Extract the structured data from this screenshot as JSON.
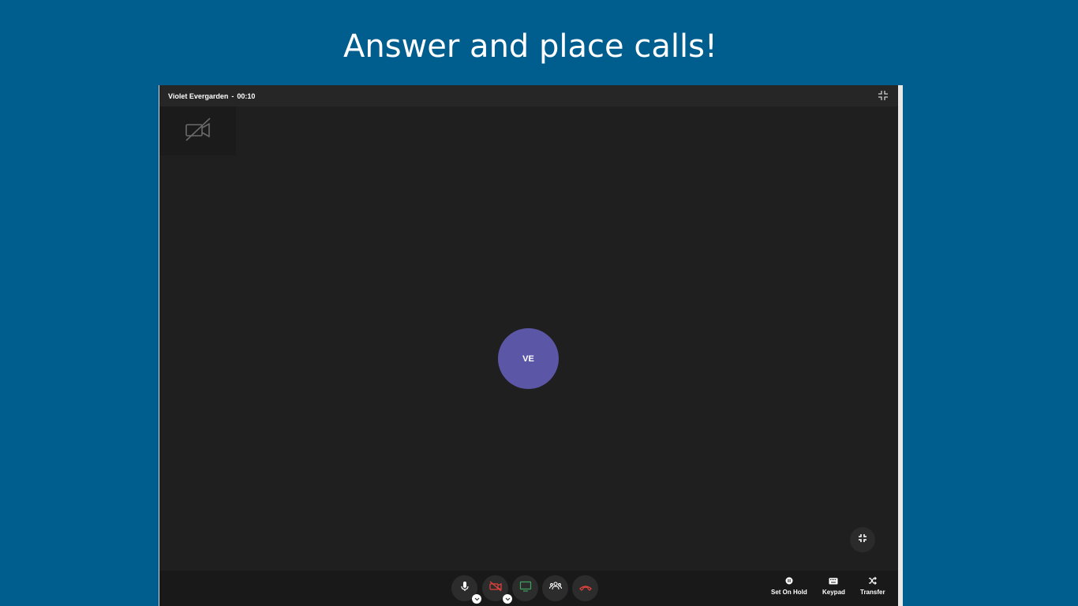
{
  "headline": "Answer and place calls!",
  "call": {
    "contact_name": "Violet Evergarden",
    "separator": "-",
    "duration": "00:10",
    "avatar_initials": "VE",
    "avatar_color": "#5b57a6"
  },
  "controls": {
    "mic_icon": "microphone-icon",
    "camera_icon": "camera-off-icon",
    "screen_share_icon": "monitor-icon",
    "participants_icon": "people-icon",
    "hangup_icon": "phone-hangup-icon"
  },
  "actions": {
    "hold_label": "Set On Hold",
    "keypad_label": "Keypad",
    "transfer_label": "Transfer"
  },
  "colors": {
    "background": "#005e8e",
    "window": "#1f1f1f",
    "danger": "#e0433b",
    "screen_share": "#3da35d"
  }
}
